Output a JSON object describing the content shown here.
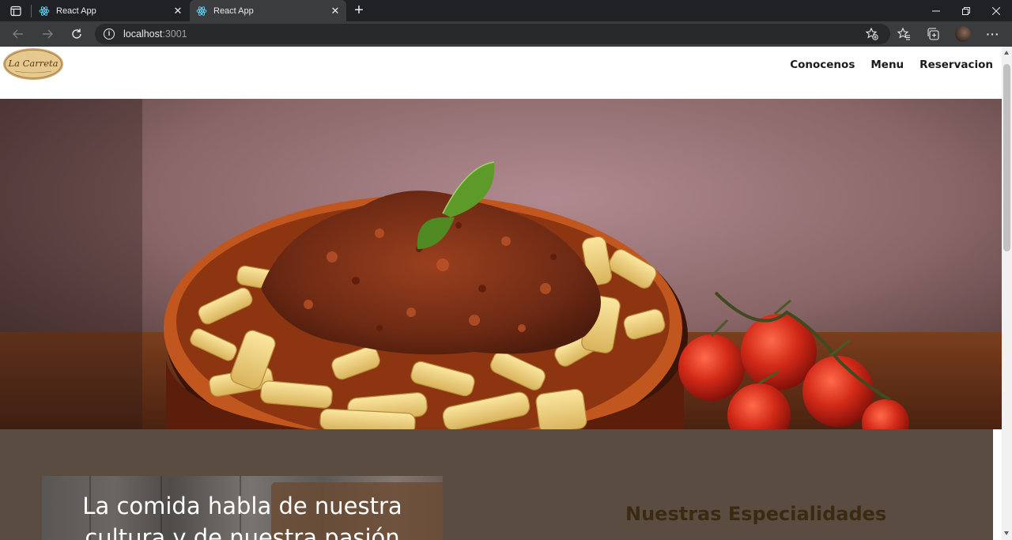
{
  "browser": {
    "tabs": [
      {
        "title": "React App",
        "active": false
      },
      {
        "title": "React App",
        "active": true
      }
    ],
    "address": {
      "host": "localhost",
      "port": ":3001"
    }
  },
  "site": {
    "logo": {
      "text": "La Carreta"
    },
    "nav": [
      {
        "label": "Conocenos"
      },
      {
        "label": "Menu"
      },
      {
        "label": "Reservacion"
      }
    ],
    "about": {
      "heading": "La comida habla de nuestra cultura y de nuestra pasión"
    },
    "specialties": {
      "heading": "Nuestras Especialidades"
    }
  },
  "colors": {
    "browser_frame": "#202124",
    "toolbar": "#3b3c3e",
    "about_bg": "#5b4c41",
    "specialties_text": "#3b2a12"
  }
}
